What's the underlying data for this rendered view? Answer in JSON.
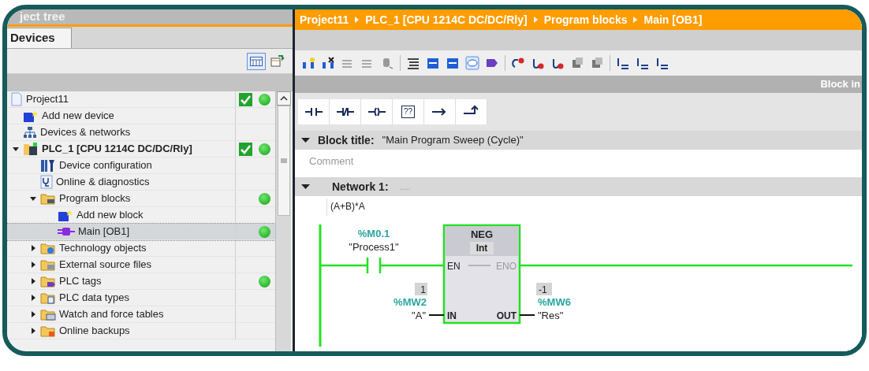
{
  "project_tree": {
    "title": "ject tree",
    "tabs": [
      {
        "label": "Devices",
        "selected": true
      }
    ],
    "items": [
      {
        "label": "Project11",
        "kind": "project",
        "selected": false,
        "consistent": true,
        "online_ok": true,
        "children": [
          {
            "label": "Add new device",
            "kind": "add-device",
            "selected": false,
            "consistent": false,
            "online_ok": false
          },
          {
            "label": "Devices & networks",
            "kind": "network",
            "selected": false,
            "consistent": false,
            "online_ok": false
          },
          {
            "label": "PLC_1 [CPU 1214C DC/DC/Rly]",
            "kind": "plc",
            "selected": false,
            "consistent": true,
            "online_ok": true,
            "expanded": true,
            "children": [
              {
                "label": "Device configuration",
                "kind": "device-config",
                "selected": false,
                "consistent": false,
                "online_ok": false
              },
              {
                "label": "Online & diagnostics",
                "kind": "diagnostics",
                "selected": false,
                "consistent": false,
                "online_ok": false
              },
              {
                "label": "Program blocks",
                "kind": "folder-blocks",
                "selected": false,
                "consistent": false,
                "online_ok": true,
                "expanded": true,
                "children": [
                  {
                    "label": "Add new block",
                    "kind": "add-block",
                    "selected": false,
                    "consistent": false,
                    "online_ok": false
                  },
                  {
                    "label": "Main [OB1]",
                    "kind": "block",
                    "selected": true,
                    "consistent": false,
                    "online_ok": true
                  }
                ]
              },
              {
                "label": "Technology objects",
                "kind": "folder-tech",
                "selected": false,
                "consistent": false,
                "online_ok": false,
                "expanded": false
              },
              {
                "label": "External source files",
                "kind": "folder-source",
                "selected": false,
                "consistent": false,
                "online_ok": false,
                "expanded": false
              },
              {
                "label": "PLC tags",
                "kind": "folder-tags",
                "selected": false,
                "consistent": false,
                "online_ok": true,
                "expanded": false
              },
              {
                "label": "PLC data types",
                "kind": "folder-types",
                "selected": false,
                "consistent": false,
                "online_ok": false,
                "expanded": false
              },
              {
                "label": "Watch and force tables",
                "kind": "folder-watch",
                "selected": false,
                "consistent": false,
                "online_ok": false,
                "expanded": false
              },
              {
                "label": "Online backups",
                "kind": "folder-backup",
                "selected": false,
                "consistent": false,
                "online_ok": false,
                "expanded": false
              }
            ]
          }
        ]
      }
    ]
  },
  "editor": {
    "breadcrumb": [
      "Project11",
      "PLC_1 [CPU 1214C DC/DC/Rly]",
      "Program blocks",
      "Main [OB1]"
    ],
    "panel_label": "Block in",
    "instructions": [
      {
        "kind": "no-contact"
      },
      {
        "kind": "nc-contact"
      },
      {
        "kind": "coil"
      },
      {
        "kind": "box",
        "label": "??"
      },
      {
        "kind": "open-branch"
      },
      {
        "kind": "close-branch"
      }
    ],
    "block_title": {
      "label": "Block title:",
      "value": "\"Main Program Sweep (Cycle)\"",
      "expanded": true
    },
    "comment_placeholder": "Comment",
    "network": {
      "label": "Network 1:",
      "title_placeholder": ".....",
      "comment": "(A+B)*A",
      "expanded": true,
      "powered": true,
      "contact": {
        "address": "%M0.1",
        "tag": "\"Process1\""
      },
      "box": {
        "name": "NEG",
        "type": "Int",
        "en": "EN",
        "eno": "ENO",
        "in": "IN",
        "out": "OUT"
      },
      "input": {
        "value": "1",
        "address": "%MW2",
        "tag": "\"A\""
      },
      "output": {
        "value": "-1",
        "address": "%MW6",
        "tag": "\"Res\""
      }
    }
  }
}
